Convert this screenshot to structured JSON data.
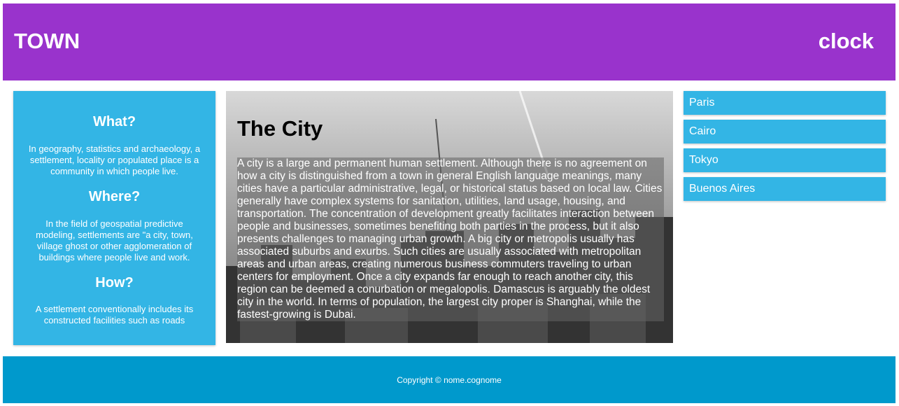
{
  "header": {
    "brand": "TOWN",
    "clock": "clock"
  },
  "left_panel": {
    "sections": [
      {
        "heading": "What?",
        "text": "In geography, statistics and archaeology, a settlement, locality or populated place is a community in which people live."
      },
      {
        "heading": "Where?",
        "text": "In the field of geospatial predictive modeling, settlements are \"a city, town, village ghost or other agglomeration of buildings where people live and work."
      },
      {
        "heading": "How?",
        "text": "A settlement conventionally includes its constructed facilities such as roads"
      }
    ]
  },
  "main": {
    "title": "The City",
    "body": "A city is a large and permanent human settlement. Although there is no agreement on how a city is distinguished from a town in general English language meanings, many cities have a particular administrative, legal, or historical status based on local law. Cities generally have complex systems for sanitation, utilities, land usage, housing, and transportation. The concentration of development greatly facilitates interaction between people and businesses, sometimes benefiting both parties in the process, but it also presents challenges to managing urban growth. A big city or metropolis usually has associated suburbs and exurbs. Such cities are usually associated with metropolitan areas and urban areas, creating numerous business commuters traveling to urban centers for employment. Once a city expands far enough to reach another city, this region can be deemed a conurbation or megalopolis. Damascus is arguably the oldest city in the world. In terms of population, the largest city proper is Shanghai, while the fastest-growing is Dubai."
  },
  "cities": [
    {
      "label": "Paris"
    },
    {
      "label": "Cairo"
    },
    {
      "label": "Tokyo"
    },
    {
      "label": "Buenos Aires"
    }
  ],
  "footer": {
    "copyright": "Copyright © nome.cognome"
  },
  "colors": {
    "header": "#9933cc",
    "panel": "#33b5e5",
    "footer": "#0099cc"
  }
}
